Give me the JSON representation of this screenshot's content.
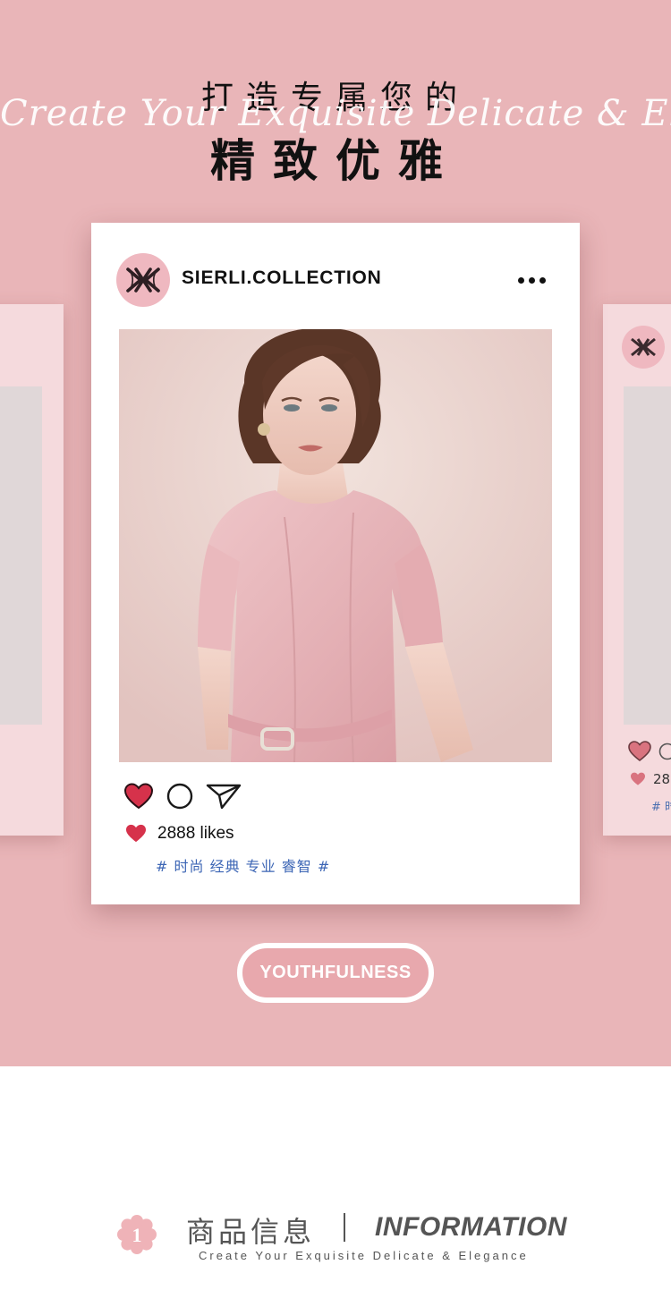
{
  "header": {
    "headline_line1": "打造专属您的",
    "script_line": "Create Your Exquisite Delicate & Elegance",
    "headline_line2": "精致优雅"
  },
  "post": {
    "username": "SIERLI.COLLECTION",
    "likes": "2888 likes",
    "hashtags": "# 时尚 经典 专业 睿智 #"
  },
  "side_card": {
    "likes_partial": "28",
    "tags_partial": "# 时"
  },
  "button": {
    "label": "YOUTHFULNESS"
  },
  "info": {
    "badge_number": "1",
    "title_cn": "商品信息",
    "title_en": "INFORMATION",
    "subtitle": "Create Your Exquisite Delicate & Elegance"
  },
  "icons": {
    "logo": "monogram-logo-icon",
    "more": "more-dots-icon",
    "like": "heart-icon",
    "comment": "comment-circle-icon",
    "share": "paper-plane-icon"
  },
  "colors": {
    "background_pink": "#e9b5b8",
    "avatar_pink": "#efb8c0",
    "heart_red": "#d6324b",
    "hashtag_blue": "#3d66b5",
    "button_fill": "#e8a8ad"
  }
}
